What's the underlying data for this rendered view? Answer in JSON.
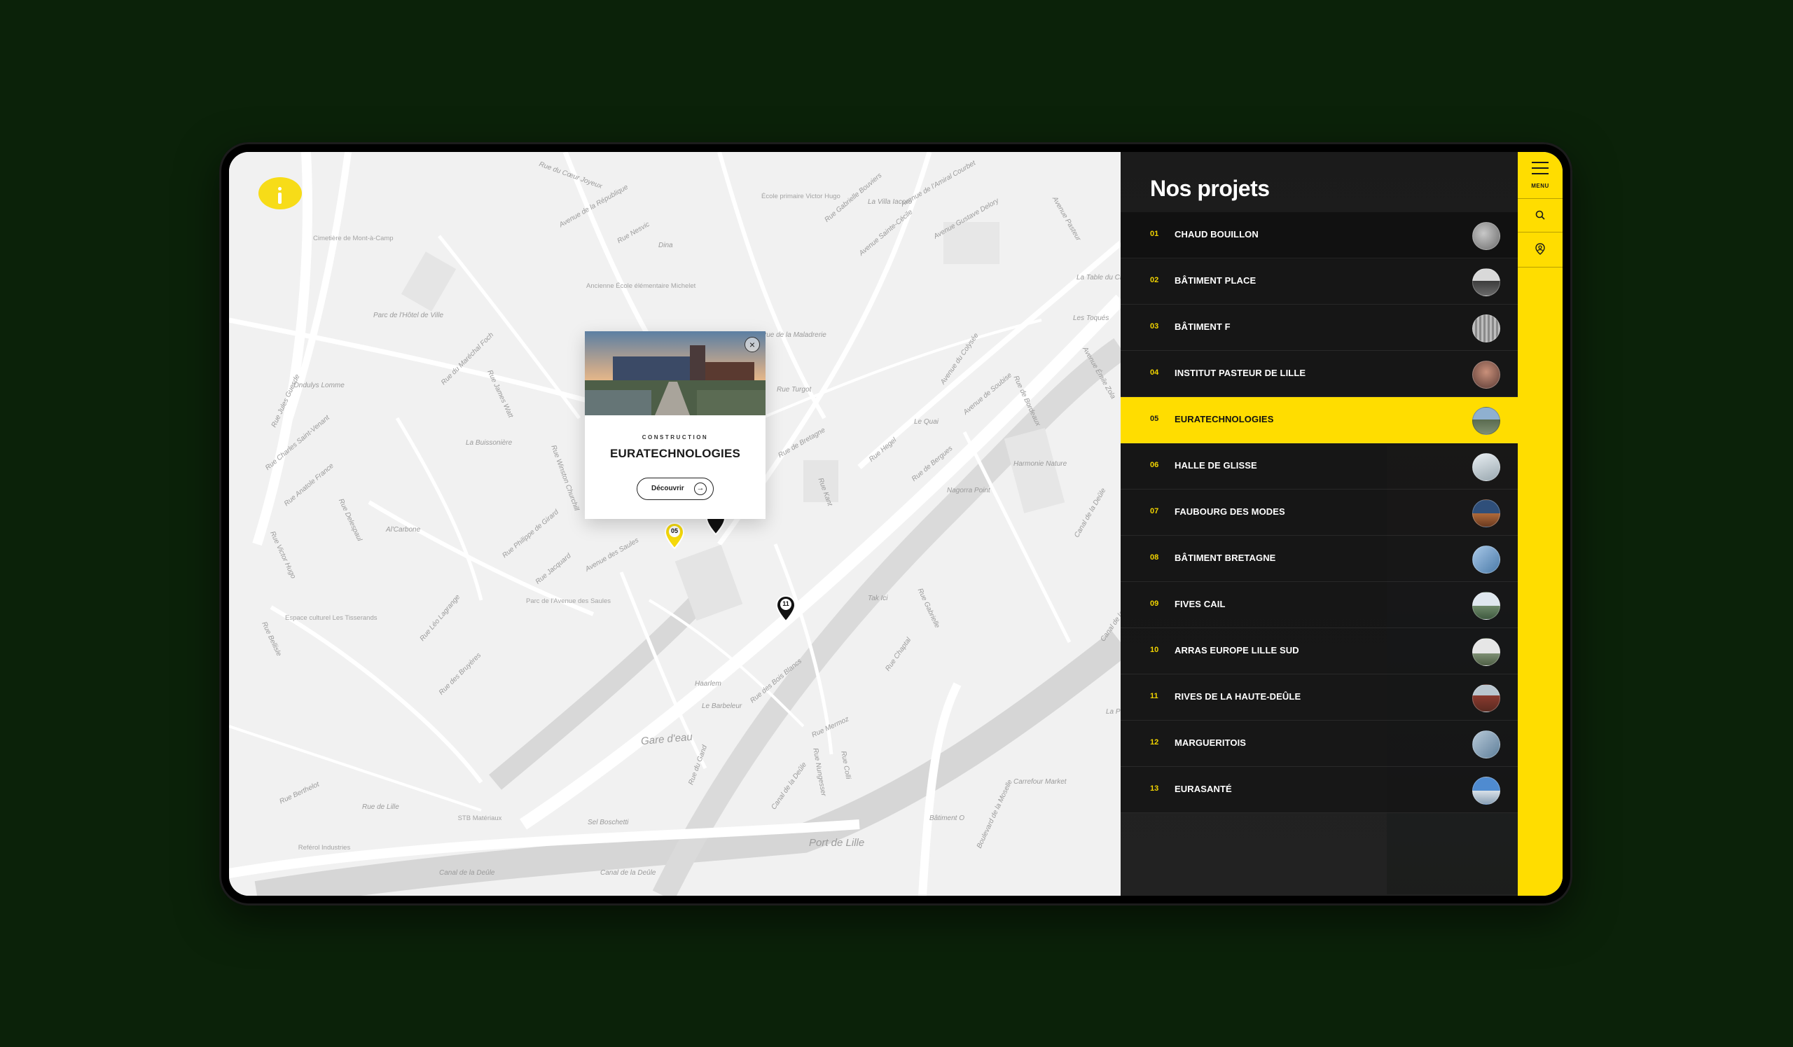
{
  "panel": {
    "title": "Nos projets",
    "projects": [
      {
        "num": "01",
        "name": "CHAUD BOUILLON"
      },
      {
        "num": "02",
        "name": "BÂTIMENT PLACE"
      },
      {
        "num": "03",
        "name": "BÂTIMENT F"
      },
      {
        "num": "04",
        "name": "INSTITUT PASTEUR DE LILLE"
      },
      {
        "num": "05",
        "name": "EURATECHNOLOGIES"
      },
      {
        "num": "06",
        "name": "HALLE DE GLISSE"
      },
      {
        "num": "07",
        "name": "FAUBOURG DES MODES"
      },
      {
        "num": "08",
        "name": "BÂTIMENT BRETAGNE"
      },
      {
        "num": "09",
        "name": "FIVES CAIL"
      },
      {
        "num": "10",
        "name": "ARRAS EUROPE LILLE SUD"
      },
      {
        "num": "11",
        "name": "RIVES DE LA HAUTE-DEÛLE"
      },
      {
        "num": "12",
        "name": "MARGUERITOIS"
      },
      {
        "num": "13",
        "name": "EURASANTÉ"
      }
    ],
    "active_index": 4
  },
  "rail": {
    "menu_label": "MENU",
    "icons": [
      "menu-icon",
      "search-icon",
      "map-pin-user-icon"
    ]
  },
  "popup": {
    "category": "CONSTRUCTION",
    "title": "EURATECHNOLOGIES",
    "button_label": "Découvrir",
    "close_symbol": "×"
  },
  "map": {
    "markers": [
      {
        "label": "05",
        "color": "#f5d90a"
      },
      {
        "label": "11",
        "color": "#111111"
      }
    ],
    "streets": [
      "Rue du Cœur Joyeux",
      "Avenue de la République",
      "Rue Nesvic",
      "Dina",
      "École primaire Victor Hugo",
      "Rue Gabrielle Bouviers",
      "La Villa Iacoro",
      "Avenue de l'Amiral Courbet",
      "Avenue Sainte-Cécile",
      "Avenue Gustave Delory",
      "Avenue Pasteur",
      "Cimetière de Mont-à-Camp",
      "Ancienne École élémentaire Michelet",
      "Parc de l'Hôtel de Ville",
      "Rue Jules Guesde",
      "Ondulys Lomme",
      "Rue du Maréchal Foch",
      "Rue James Watt",
      "Rue Charles Saint-Venant",
      "La Buissonière",
      "Rue Anatole France",
      "Rue Delespaul",
      "Al'Carbone",
      "Rue Victor Hugo",
      "Espace culturel Les Tisserands",
      "Rue Bellisle",
      "Rue Léo Lagrange",
      "Rue des Bruyères",
      "Rue Berthelot",
      "Rue de Lille",
      "STB Matériaux",
      "Reférol Industries",
      "Rue de la Maladrerie",
      "Rue Turgot",
      "Rue de Bretagne",
      "Avenue du Colysée",
      "Avenue de Soubise",
      "Le Quai",
      "Rue Hegel",
      "Rue Kant",
      "Rue de Bergues",
      "Nagorra Point",
      "Harmonie Nature",
      "Rue Winston Churchill",
      "Rue Philippe de Girard",
      "Rue Jacquard",
      "Avenue des Saules",
      "Parc de l'Avenue des Saules",
      "Rue de Bordeaux",
      "La Table du Chef",
      "Les Toqués",
      "Avenue Émile Zola",
      "Canal de la Deûle",
      "Tak Ici",
      "Rue Gabrielle",
      "Rue Chaptal",
      "Haarlem",
      "Le Barbeleur",
      "Gare d'eau",
      "Rue des Bois Blancs",
      "Rue Mermoz",
      "Rue du Gand",
      "Rue Nungesser",
      "Rue Colli",
      "Sel Boschetti",
      "Port de Lille",
      "Bâtiment O",
      "Boulevard de la Moselle",
      "Carrefour Market",
      "La Pê"
    ]
  }
}
